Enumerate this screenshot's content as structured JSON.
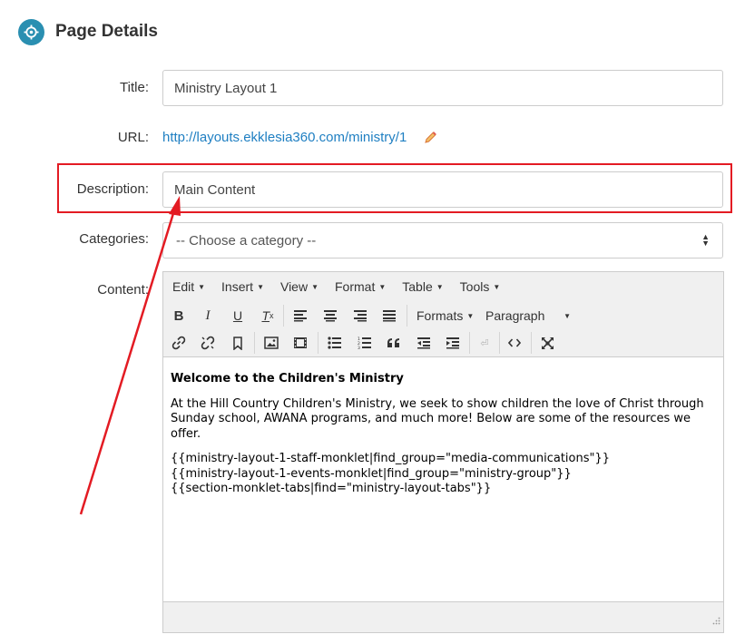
{
  "header": {
    "title": "Page Details",
    "icon": "crosshair-icon",
    "icon_color": "#2a8fb1"
  },
  "form": {
    "title_label": "Title:",
    "title_value": "Ministry Layout 1",
    "url_label": "URL:",
    "url_value": "http://layouts.ekklesia360.com/ministry/1",
    "description_label": "Description:",
    "description_value": "Main Content",
    "categories_label": "Categories:",
    "categories_selected": "-- Choose a category --",
    "content_label": "Content:"
  },
  "editor": {
    "menus": [
      "Edit",
      "Insert",
      "View",
      "Format",
      "Table",
      "Tools"
    ],
    "formats_label": "Formats",
    "paragraph_label": "Paragraph",
    "content": {
      "heading": "Welcome to the Children's Ministry",
      "paragraph": "At the Hill Country Children's Ministry, we seek to show children the love of Christ through Sunday school, AWANA programs, and much more! Below are some of the resources we offer.",
      "tags": [
        "{{ministry-layout-1-staff-monklet|find_group=\"media-communications\"}}",
        "{{ministry-layout-1-events-monklet|find_group=\"ministry-group\"}}",
        "{{section-monklet-tabs|find=\"ministry-layout-tabs\"}}"
      ]
    }
  },
  "colors": {
    "link": "#1f7fc2",
    "annotation": "#e31b23",
    "toolbar_bg": "#f0f0f0"
  }
}
